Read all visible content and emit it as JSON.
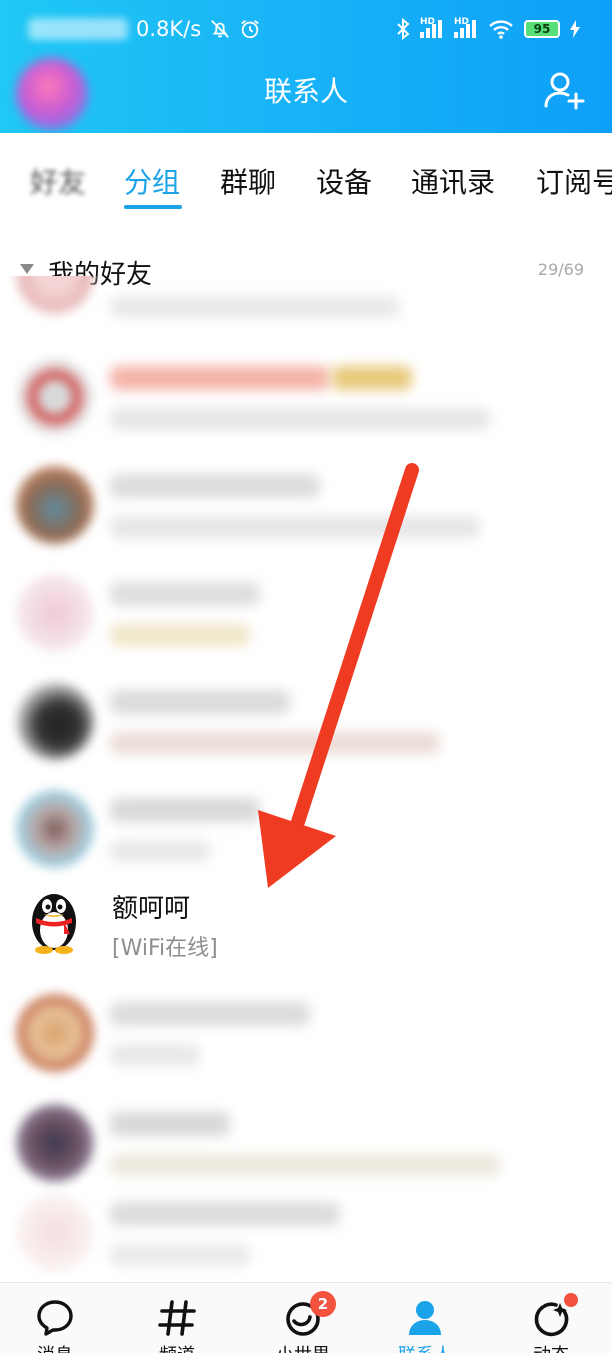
{
  "status_bar": {
    "net_speed": "0.8K/s",
    "battery": "95",
    "hd_label": "HD"
  },
  "header": {
    "title": "联系人"
  },
  "tabs": [
    {
      "label": "好友"
    },
    {
      "label": "分组"
    },
    {
      "label": "群聊"
    },
    {
      "label": "设备"
    },
    {
      "label": "通讯录"
    },
    {
      "label": "订阅号"
    }
  ],
  "group": {
    "name": "我的好友",
    "count": "29/69"
  },
  "contacts": [
    {
      "name": "额呵呵",
      "status": "[WiFi在线]"
    }
  ],
  "bottom_nav": [
    {
      "label": "消息",
      "icon": "chat-bubble-icon"
    },
    {
      "label": "频道",
      "icon": "hash-icon"
    },
    {
      "label": "小世界",
      "icon": "planet-icon",
      "badge": "2"
    },
    {
      "label": "联系人",
      "icon": "contacts-person-icon"
    },
    {
      "label": "动态",
      "icon": "star-circle-icon"
    }
  ],
  "colors": {
    "accent": "#1aa3e8",
    "header_gradient_start": "#20c8f5",
    "header_gradient_end": "#0ea0f8",
    "badge": "#f3523f",
    "arrow": "#ef3b22"
  }
}
